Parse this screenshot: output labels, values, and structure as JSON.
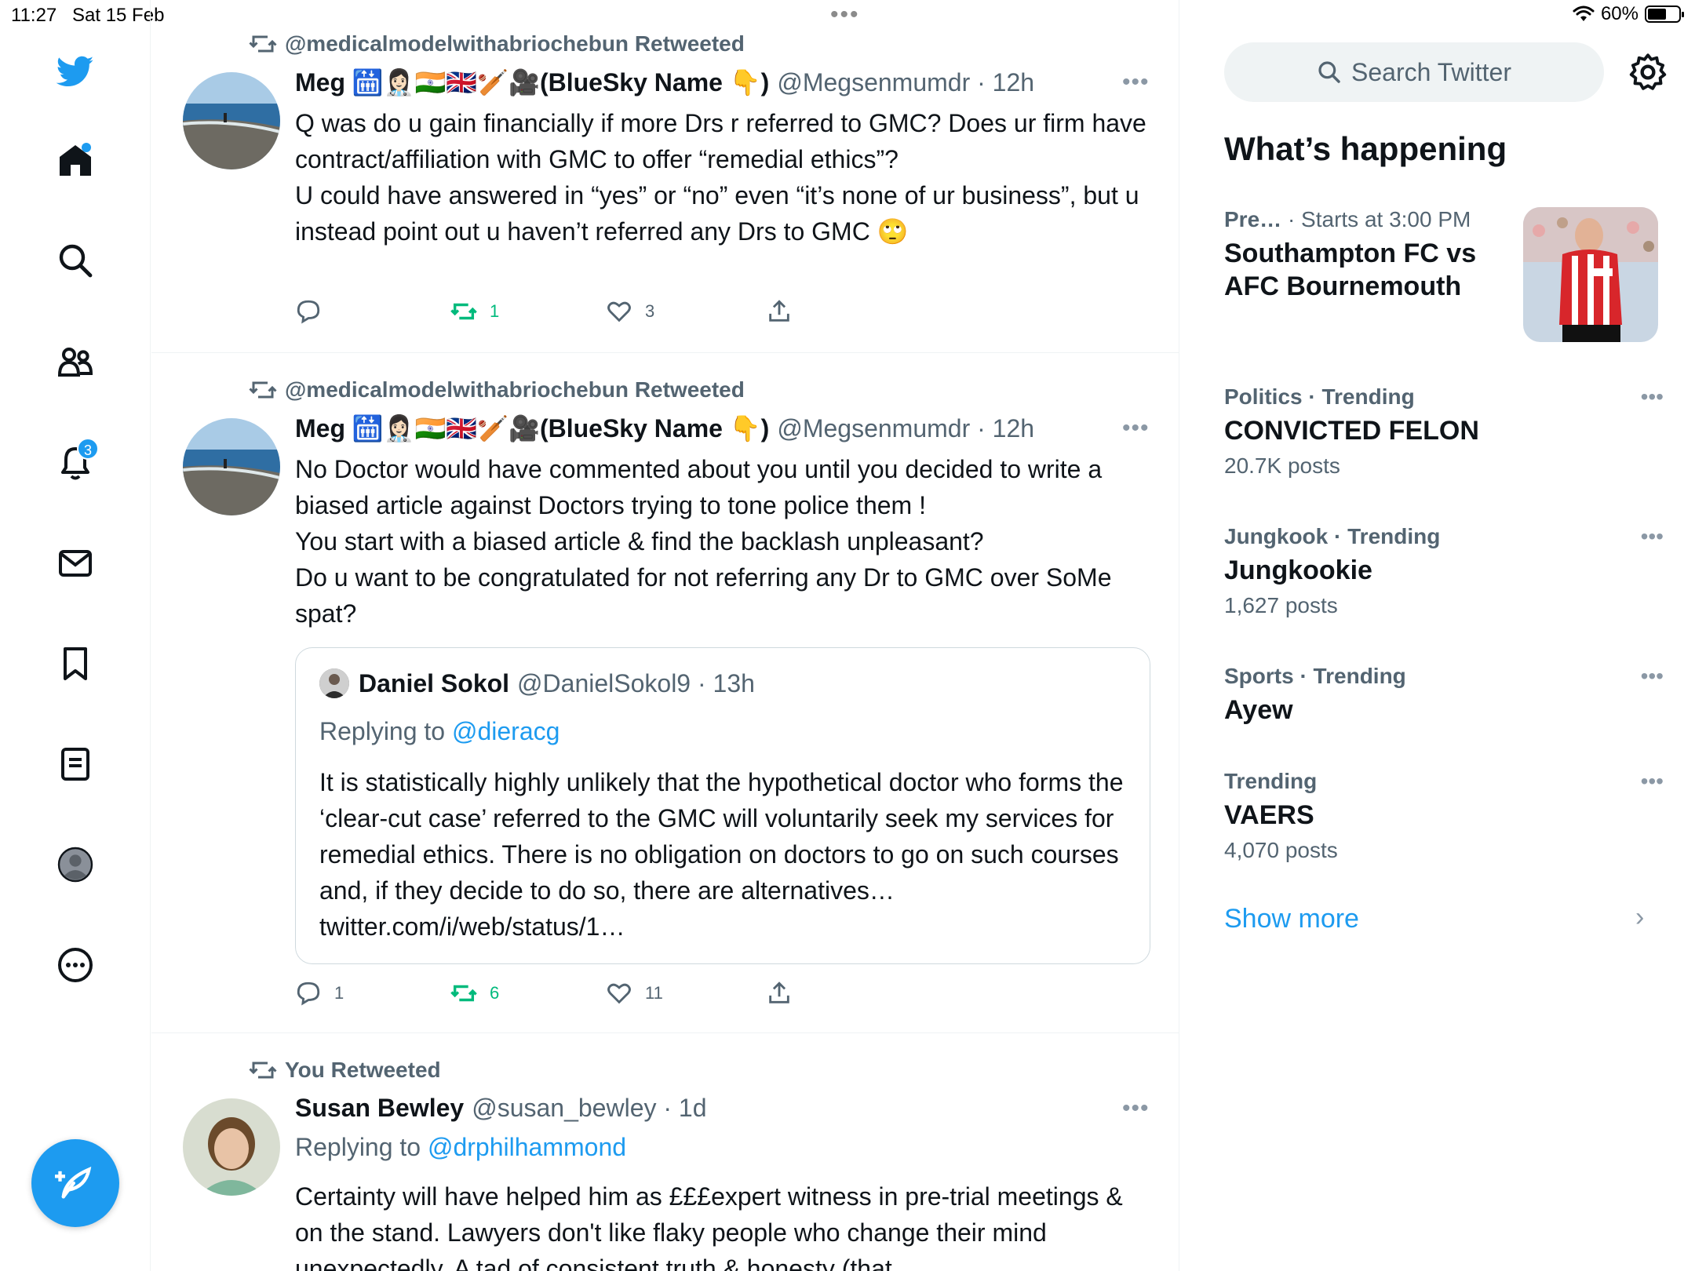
{
  "status": {
    "time": "11:27",
    "date": "Sat 15 Feb",
    "battery": "60%",
    "battery_level": 0.6
  },
  "nav": {
    "notifications_badge": "3",
    "icons": [
      "twitter-logo-icon",
      "home-icon",
      "search-icon",
      "communities-icon",
      "notifications-icon",
      "messages-icon",
      "bookmarks-icon",
      "lists-icon",
      "profile-icon",
      "more-icon",
      "compose-icon"
    ]
  },
  "tweets": [
    {
      "retweeted_by": "@medicalmodelwithabriochebun Retweeted",
      "name": "Meg 🛗👩🏻‍⚕️🇮🇳🇬🇧🏏🎥(BlueSky Name 👇)",
      "handle": "@Megsenmumdr · 12h",
      "body": "Q was do u gain financially if more Drs r referred to GMC? Does ur firm have contract/affiliation with GMC to offer “remedial ethics”?\nU could have answered in “yes” or “no” even “it’s none of ur business”, but u instead point out u haven’t referred any Drs to GMC 🙄",
      "replies": "",
      "retweets": "1",
      "likes": "3"
    },
    {
      "retweeted_by": "@medicalmodelwithabriochebun Retweeted",
      "name": "Meg 🛗👩🏻‍⚕️🇮🇳🇬🇧🏏🎥(BlueSky Name 👇)",
      "handle": "@Megsenmumdr · 12h",
      "body": "No Doctor would have commented about you until you decided to write a biased article against Doctors trying to tone police them !\nYou start with a biased article & find the backlash unpleasant?\nDo u want to be congratulated for not referring any Dr to GMC over SoMe spat?",
      "quote": {
        "name": "Daniel Sokol",
        "handle": "@DanielSokol9 · 13h",
        "replying_label": "Replying to",
        "replying_to": "@dieracg",
        "body": "It is statistically highly unlikely that the hypothetical doctor who forms the ‘clear-cut case’ referred to the GMC will voluntarily seek my services for remedial ethics. There is no obligation on doctors to go on such courses and, if they decide to do so, there are alternatives… twitter.com/i/web/status/1…"
      },
      "replies": "1",
      "retweets": "6",
      "likes": "11"
    },
    {
      "retweeted_by": "You Retweeted",
      "name": "Susan Bewley",
      "handle": "@susan_bewley · 1d",
      "replying_label": "Replying to",
      "replying_to": "@drphilhammond",
      "body": "Certainty will have helped him as £££expert witness in pre-trial meetings & on the stand. Lawyers don't like flaky people who change their mind unexpectedly. A tad of consistent truth & honesty (that"
    }
  ],
  "sidebar": {
    "search_placeholder": "Search Twitter",
    "whats_happening": "What’s happening",
    "event": {
      "category": "Pre…",
      "time": "· Starts at 3:00 PM",
      "title": "Southampton FC vs AFC Bournemouth"
    },
    "trends": [
      {
        "category": "Politics · Trending",
        "title": "CONVICTED FELON",
        "count": "20.7K posts"
      },
      {
        "category": "Jungkook · Trending",
        "title": "Jungkookie",
        "count": "1,627 posts"
      },
      {
        "category": "Sports · Trending",
        "title": "Ayew",
        "count": ""
      },
      {
        "category": "Trending",
        "title": "VAERS",
        "count": "4,070 posts"
      }
    ],
    "show_more": "Show more"
  },
  "colors": {
    "accent": "#1d9bf0",
    "retweet_green": "#00ba7c",
    "secondary_text": "#536471"
  }
}
